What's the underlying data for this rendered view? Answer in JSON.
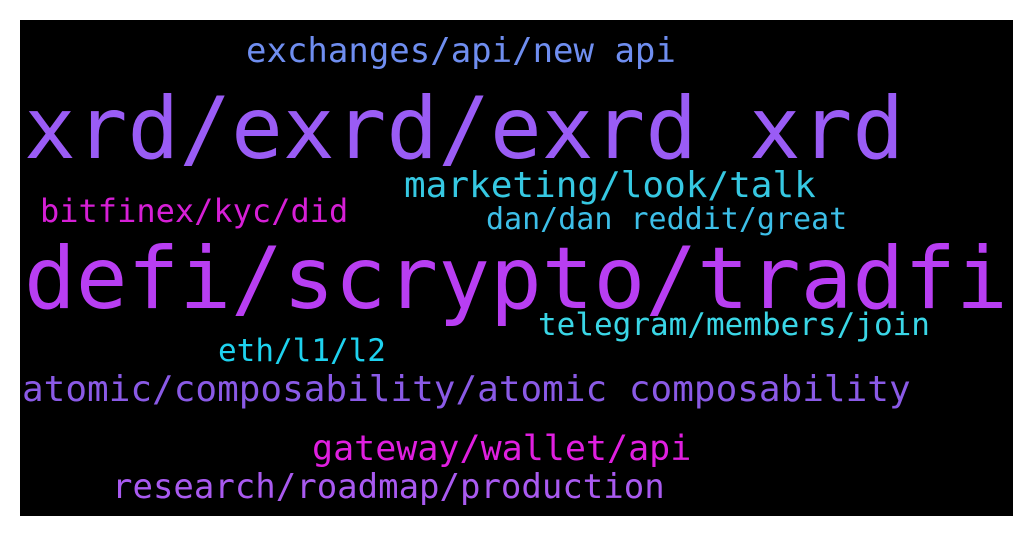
{
  "words": [
    {
      "text": "exchanges/api/new api",
      "color": "#6f8ef0"
    },
    {
      "text": "xrd/exrd/exrd xrd",
      "color": "#9a5cf5"
    },
    {
      "text": "marketing/look/talk",
      "color": "#36c8e2"
    },
    {
      "text": "bitfinex/kyc/did",
      "color": "#d61fd6"
    },
    {
      "text": "dan/dan reddit/great",
      "color": "#3dbfe8"
    },
    {
      "text": "defi/scrypto/tradfi",
      "color": "#b83ef2"
    },
    {
      "text": "telegram/members/join",
      "color": "#3ad6e6"
    },
    {
      "text": "eth/l1/l2",
      "color": "#1ed2ef"
    },
    {
      "text": "atomic/composability/atomic composability",
      "color": "#8a5ae6"
    },
    {
      "text": "gateway/wallet/api",
      "color": "#e01fe0"
    },
    {
      "text": "research/roadmap/production",
      "color": "#a95af0"
    }
  ],
  "background_color": "#000000"
}
